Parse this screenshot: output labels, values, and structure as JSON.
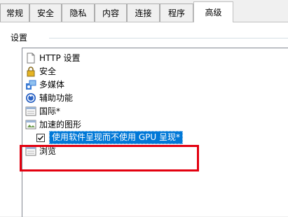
{
  "tabs": [
    {
      "label": "常规",
      "active": false
    },
    {
      "label": "安全",
      "active": false
    },
    {
      "label": "隐私",
      "active": false
    },
    {
      "label": "内容",
      "active": false
    },
    {
      "label": "连接",
      "active": false
    },
    {
      "label": "程序",
      "active": false
    },
    {
      "label": "高级",
      "active": true
    }
  ],
  "settings_group": {
    "title": "设置"
  },
  "tree": {
    "items": [
      {
        "label": "HTTP 设置",
        "icon": "page-icon"
      },
      {
        "label": "安全",
        "icon": "lock-icon"
      },
      {
        "label": "多媒体",
        "icon": "multimedia-icon"
      },
      {
        "label": "辅助功能",
        "icon": "accessibility-icon"
      },
      {
        "label": "国际*",
        "icon": "window-icon"
      },
      {
        "label": "加速的图形",
        "icon": "window-icon"
      },
      {
        "label": "使用软件呈现而不使用 GPU 呈现*",
        "icon": "checkbox",
        "checked": true,
        "selected": true
      },
      {
        "label": "浏览",
        "icon": "window-icon"
      }
    ]
  },
  "colors": {
    "selection": "#0078d7",
    "highlight": "#e3000f"
  }
}
